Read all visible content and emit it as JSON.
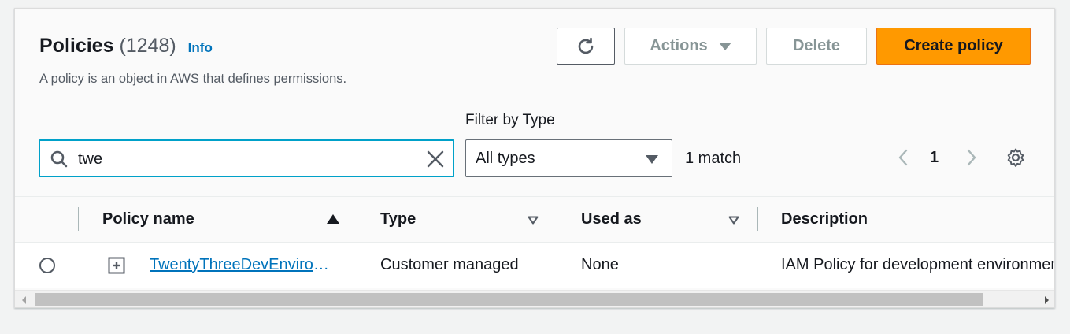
{
  "header": {
    "title": "Policies",
    "count": "(1248)",
    "info_link": "Info",
    "description": "A policy is an object in AWS that defines permissions."
  },
  "toolbar": {
    "refresh_icon": "refresh-icon",
    "actions_label": "Actions",
    "delete_label": "Delete",
    "create_label": "Create policy"
  },
  "filters": {
    "type_label": "Filter by Type",
    "search_value": "twe",
    "type_selected": "All types",
    "match_text": "1 match"
  },
  "pagination": {
    "current_page": "1"
  },
  "table": {
    "columns": [
      "Policy name",
      "Type",
      "Used as",
      "Description"
    ],
    "rows": [
      {
        "name": "TwentyThreeDevEnvironmentPolicy",
        "type": "Customer managed",
        "used_as": "None",
        "description": "IAM Policy for development environment"
      }
    ]
  },
  "colors": {
    "primary": "#ff9900",
    "link": "#0073bb",
    "focus": "#00a1c9"
  }
}
